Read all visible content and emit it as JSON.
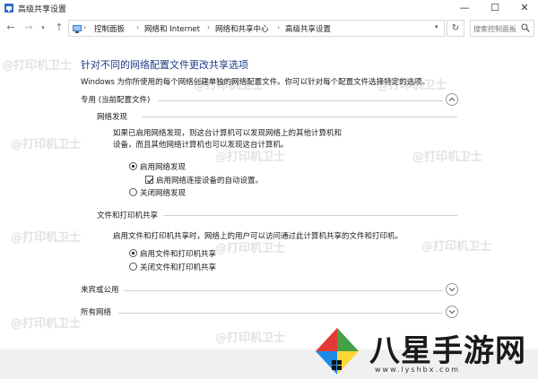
{
  "window": {
    "title": "高级共享设置",
    "minimize": "—",
    "maximize": "☐",
    "close": "✕"
  },
  "nav": {
    "back": "←",
    "forward": "→",
    "dropdown": "▾",
    "up": "↑",
    "refresh": "↻"
  },
  "breadcrumb": {
    "items": [
      "控制面板",
      "网络和 Internet",
      "网络和共享中心",
      "高级共享设置"
    ],
    "separator": "›",
    "dropdown": "▾"
  },
  "search": {
    "placeholder": "搜索控制面板"
  },
  "page": {
    "title": "针对不同的网络配置文件更改共享选项",
    "description": "Windows 为你所使用的每个网络创建单独的网络配置文件。你可以针对每个配置文件选择特定的选项。"
  },
  "private_profile": {
    "label": "专用 (当前配置文件)",
    "network_discovery": {
      "title": "网络发现",
      "description": "如果已启用网络发现，则这台计算机可以发现网络上的其他计算机和设备，而且其他网络计算机也可以发现这台计算机。",
      "turn_on": "启用网络发现",
      "auto_setup": "启用网络连接设备的自动设置。",
      "turn_off": "关闭网络发现"
    },
    "file_printer_sharing": {
      "title": "文件和打印机共享",
      "description": "启用文件和打印机共享时，网络上的用户可以访问通过此计算机共享的文件和打印机。",
      "turn_on": "启用文件和打印机共享",
      "turn_off": "关闭文件和打印机共享"
    }
  },
  "guest_public_profile": {
    "label": "来宾或公用"
  },
  "all_networks_profile": {
    "label": "所有网络"
  },
  "watermark": {
    "text": "@打印机卫士"
  },
  "logo": {
    "name": "八星手游网",
    "url": "www.lyshbx.com"
  },
  "colors": {
    "title_blue": "#1e3b8a",
    "line_gray": "#d0d0d0"
  }
}
